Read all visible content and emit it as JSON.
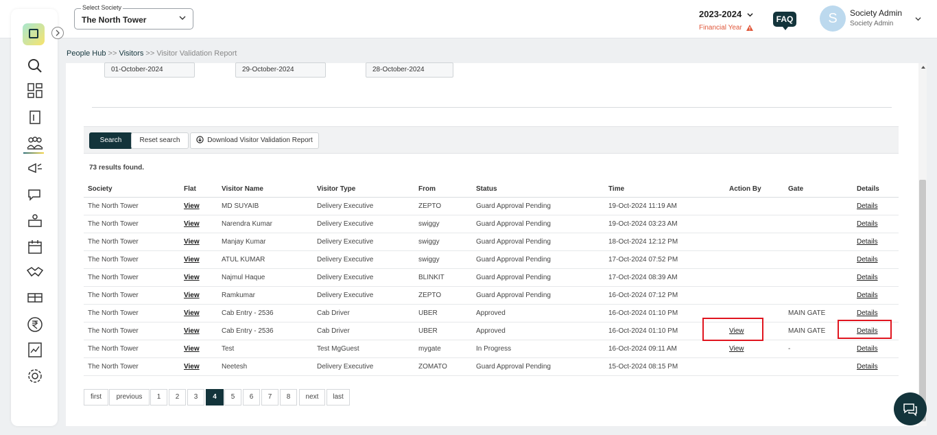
{
  "header": {
    "society_label": "Select Society",
    "society_value": "The North Tower",
    "financial_year": "2023-2024",
    "financial_year_label": "Financial Year",
    "faq_label": "FAQ",
    "avatar_letter": "S",
    "user_name": "Society Admin",
    "user_role": "Society Admin"
  },
  "sidebar": {
    "icons": [
      "logo-icon",
      "search-icon",
      "dashboard-icon",
      "building-icon",
      "people-icon",
      "megaphone-icon",
      "chat-icon",
      "services-icon",
      "calendar-icon",
      "handshake-icon",
      "amenities-icon",
      "rupee-icon",
      "report-icon",
      "settings-icon"
    ]
  },
  "breadcrumb": {
    "item1": "People Hub",
    "sep1": " >> ",
    "item2": "Visitors",
    "sep2": " >> ",
    "item3": "Visitor Validation Report"
  },
  "filters": {
    "date1": "01-October-2024",
    "date2": "29-October-2024",
    "date3": "28-October-2024"
  },
  "actions": {
    "search": "Search",
    "reset": "Reset search",
    "download": "Download Visitor Validation Report"
  },
  "results_text": "73 results found.",
  "table": {
    "headers": [
      "Society",
      "Flat",
      "Visitor Name",
      "Visitor Type",
      "From",
      "Status",
      "Time",
      "Action By",
      "Gate",
      "Details"
    ],
    "rows": [
      {
        "society": "The North Tower",
        "flat": "View",
        "name": "MD SUYAIB",
        "type": "Delivery Executive",
        "from": "ZEPTO",
        "status": "Guard Approval Pending",
        "time": "19-Oct-2024 11:19 AM",
        "action_by": "",
        "gate": "",
        "details": "Details"
      },
      {
        "society": "The North Tower",
        "flat": "View",
        "name": "Narendra Kumar",
        "type": "Delivery Executive",
        "from": "swiggy",
        "status": "Guard Approval Pending",
        "time": "19-Oct-2024 03:23 AM",
        "action_by": "",
        "gate": "",
        "details": "Details"
      },
      {
        "society": "The North Tower",
        "flat": "View",
        "name": "Manjay Kumar",
        "type": "Delivery Executive",
        "from": "swiggy",
        "status": "Guard Approval Pending",
        "time": "18-Oct-2024 12:12 PM",
        "action_by": "",
        "gate": "",
        "details": "Details"
      },
      {
        "society": "The North Tower",
        "flat": "View",
        "name": "ATUL KUMAR",
        "type": "Delivery Executive",
        "from": "swiggy",
        "status": "Guard Approval Pending",
        "time": "17-Oct-2024 07:52 PM",
        "action_by": "",
        "gate": "",
        "details": "Details"
      },
      {
        "society": "The North Tower",
        "flat": "View",
        "name": "Najmul Haque",
        "type": "Delivery Executive",
        "from": "BLINKIT",
        "status": "Guard Approval Pending",
        "time": "17-Oct-2024 08:39 AM",
        "action_by": "",
        "gate": "",
        "details": "Details"
      },
      {
        "society": "The North Tower",
        "flat": "View",
        "name": "Ramkumar",
        "type": "Delivery Executive",
        "from": "ZEPTO",
        "status": "Guard Approval Pending",
        "time": "16-Oct-2024 07:12 PM",
        "action_by": "",
        "gate": "",
        "details": "Details"
      },
      {
        "society": "The North Tower",
        "flat": "View",
        "name": "Cab Entry - 2536",
        "type": "Cab Driver",
        "from": "UBER",
        "status": "Approved",
        "time": "16-Oct-2024 01:10 PM",
        "action_by": "",
        "gate": "MAIN GATE",
        "details": "Details"
      },
      {
        "society": "The North Tower",
        "flat": "View",
        "name": "Cab Entry - 2536",
        "type": "Cab Driver",
        "from": "UBER",
        "status": "Approved",
        "time": "16-Oct-2024 01:10 PM",
        "action_by": "View",
        "gate": "MAIN GATE",
        "details": "Details"
      },
      {
        "society": "The North Tower",
        "flat": "View",
        "name": "Test",
        "type": "Test MgGuest",
        "from": "mygate",
        "status": "In Progress",
        "time": "16-Oct-2024 09:11 AM",
        "action_by": "View",
        "gate": "-",
        "details": "Details"
      },
      {
        "society": "The North Tower",
        "flat": "View",
        "name": "Neetesh",
        "type": "Delivery Executive",
        "from": "ZOMATO",
        "status": "Guard Approval Pending",
        "time": "15-Oct-2024 08:15 PM",
        "action_by": "",
        "gate": "",
        "details": "Details"
      }
    ]
  },
  "pagination": {
    "first": "first",
    "previous": "previous",
    "pages": [
      "1",
      "2",
      "3",
      "4",
      "5",
      "6",
      "7",
      "8"
    ],
    "current": "4",
    "next": "next",
    "last": "last"
  },
  "colors": {
    "primary": "#13343b",
    "highlight": "#e0141e",
    "warning": "#e0573a"
  }
}
